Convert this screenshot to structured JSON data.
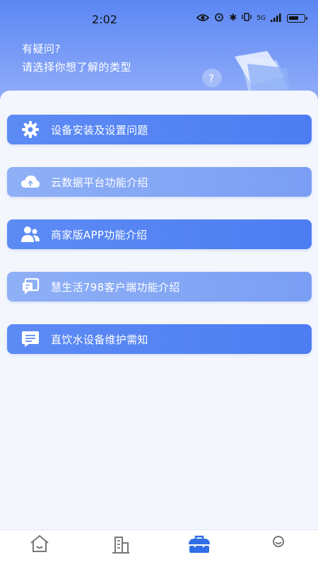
{
  "status_bar": {
    "time": "2:02",
    "network": "5G",
    "battery_level": 0.7
  },
  "header": {
    "title": "有疑问?",
    "subtitle": "请选择你想了解的类型",
    "illustration_icon": "help-folder-illustration"
  },
  "menu": [
    {
      "label": "设备安装及设置问题",
      "icon": "gear-icon",
      "style": "dark"
    },
    {
      "label": "云数据平台功能介绍",
      "icon": "cloud-icon",
      "style": "light"
    },
    {
      "label": "商家版APP功能介绍",
      "icon": "users-icon",
      "style": "dark"
    },
    {
      "label": "慧生活798客户端功能介绍",
      "icon": "chat-device-icon",
      "style": "light"
    },
    {
      "label": "直饮水设备维护需知",
      "icon": "message-icon",
      "style": "dark"
    }
  ],
  "tabbar": {
    "tabs": [
      {
        "icon": "home-icon",
        "active": false
      },
      {
        "icon": "building-icon",
        "active": false
      },
      {
        "icon": "toolbox-icon",
        "active": true
      },
      {
        "icon": "profile-icon",
        "active": false
      }
    ],
    "active_color": "#2f6ee6",
    "inactive_color": "#777777"
  },
  "colors": {
    "header_top": "#5b87f4",
    "menu_dark": "#5d8bf4",
    "menu_light": "#8fb0f6",
    "background": "#f3f6fd"
  }
}
